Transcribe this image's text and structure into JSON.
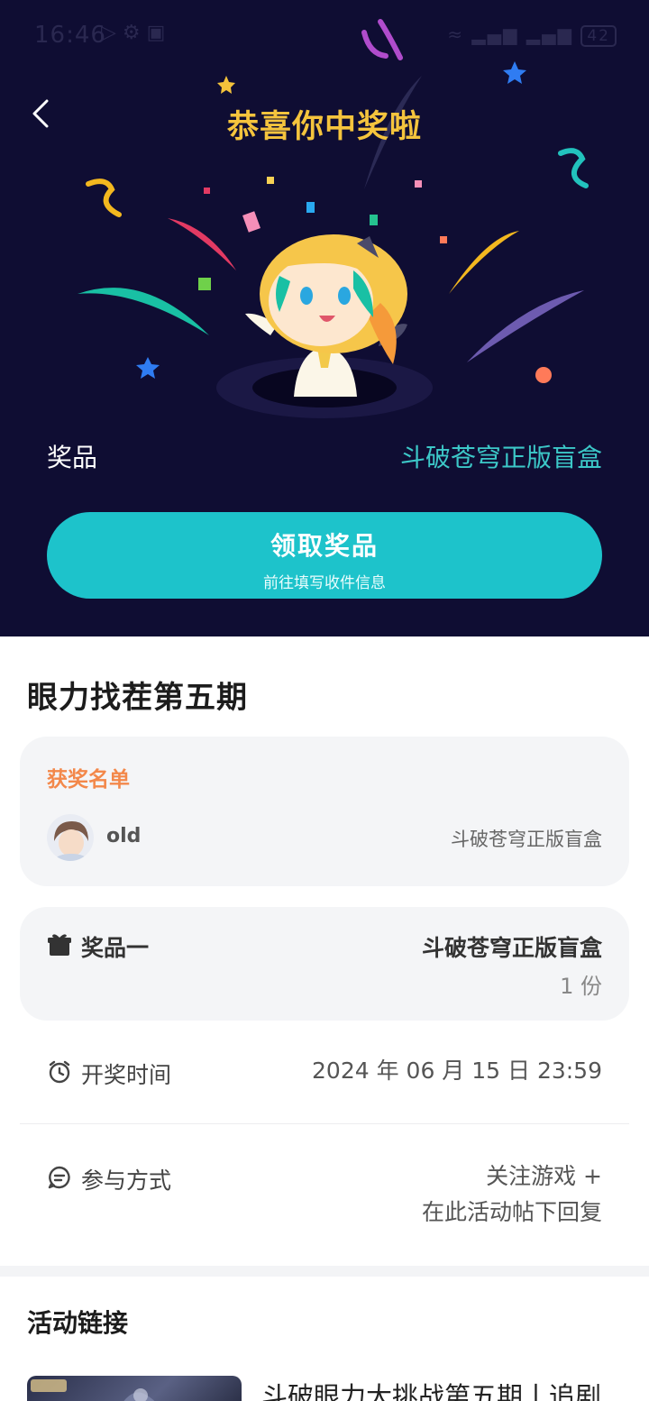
{
  "status_bar": {
    "time": "16:46",
    "battery": "42"
  },
  "hero": {
    "title": "恭喜你中奖啦",
    "prize_label": "奖品",
    "prize_value": "斗破苍穹正版盲盒",
    "claim_button": {
      "title": "领取奖品",
      "subtitle": "前往填写收件信息"
    }
  },
  "event": {
    "title": "眼力找茬第五期"
  },
  "winners": {
    "title": "获奖名单",
    "items": [
      {
        "name": "old",
        "prize": "斗破苍穹正版盲盒"
      }
    ]
  },
  "prize": {
    "label": "奖品一",
    "name": "斗破苍穹正版盲盒",
    "quantity": "1 份"
  },
  "draw_time": {
    "label": "开奖时间",
    "value": "2024 年 06 月 15 日 23:59"
  },
  "participation": {
    "label": "参与方式",
    "line1": "关注游戏 +",
    "line2": "在此活动帖下回复"
  },
  "links": {
    "title": "活动链接",
    "items": [
      {
        "text": "斗破眼力大挑战第五期丨追剧"
      }
    ]
  },
  "colors": {
    "hero_bg": "#0f0d33",
    "accent_yellow": "#f5c43d",
    "accent_teal": "#1dc3cb",
    "winners_orange": "#f3884a"
  }
}
